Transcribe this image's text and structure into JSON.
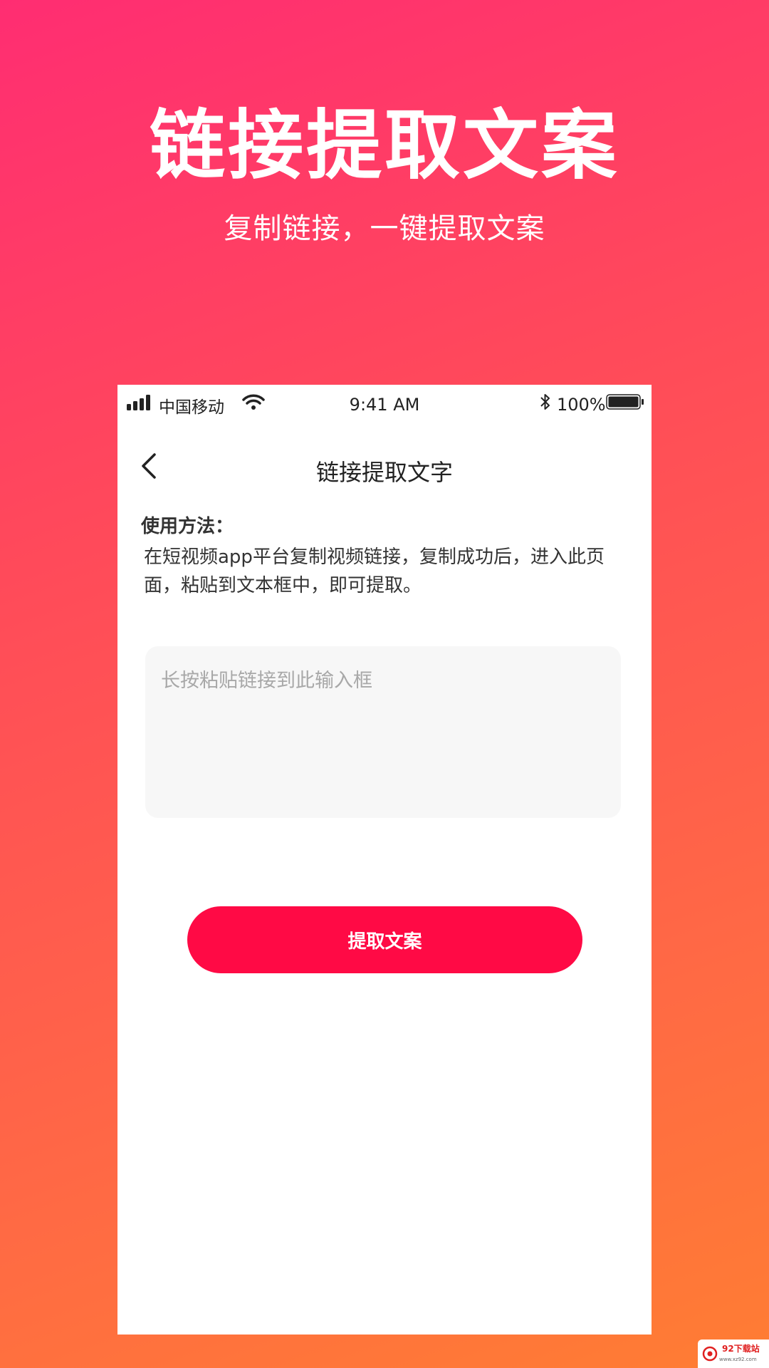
{
  "promo": {
    "title": "链接提取文案",
    "subtitle": "复制链接，一键提取文案"
  },
  "statusbar": {
    "carrier": "中国移动",
    "time": "9:41 AM",
    "battery": "100%"
  },
  "navbar": {
    "title": "链接提取文字"
  },
  "instructions": {
    "label": "使用方法：",
    "text": "在短视频app平台复制视频链接，复制成功后，进入此页面，粘贴到文本框中，即可提取。"
  },
  "input": {
    "placeholder": "长按粘贴链接到此输入框",
    "value": ""
  },
  "actions": {
    "extract_label": "提取文案"
  },
  "watermark": {
    "name": "92下载站",
    "url": "www.xz92.com"
  },
  "colors": {
    "accent": "#ff0a45",
    "gradient_start": "#ff2d72",
    "gradient_end": "#ff7d33"
  },
  "icons": [
    "signal-icon",
    "wifi-icon",
    "bluetooth-icon",
    "battery-icon",
    "back-arrow-icon"
  ]
}
